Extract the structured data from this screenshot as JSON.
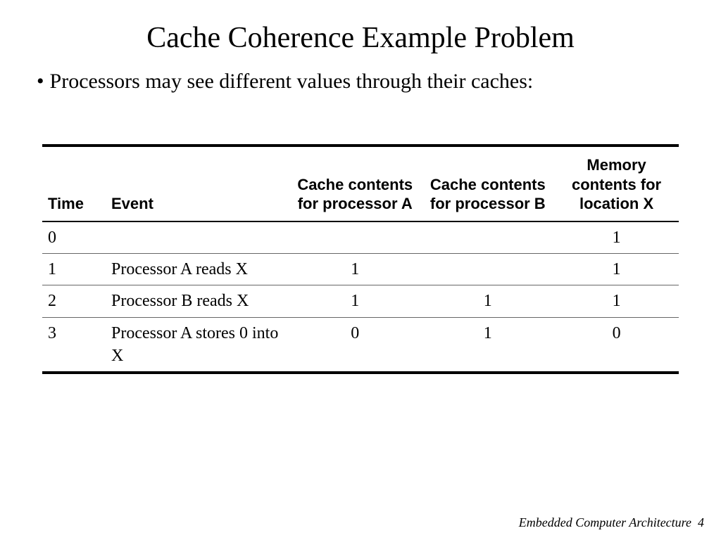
{
  "title": "Cache Coherence Example Problem",
  "bullet": "Processors may see different values through their caches:",
  "table": {
    "headers": {
      "time": "Time",
      "event": "Event",
      "a": "Cache contents for processor A",
      "b": "Cache contents for processor B",
      "x": "Memory contents for location X"
    },
    "rows": [
      {
        "time": "0",
        "event": "",
        "a": "",
        "b": "",
        "x": "1"
      },
      {
        "time": "1",
        "event": "Processor A reads X",
        "a": "1",
        "b": "",
        "x": "1"
      },
      {
        "time": "2",
        "event": "Processor B reads X",
        "a": "1",
        "b": "1",
        "x": "1"
      },
      {
        "time": "3",
        "event": "Processor A stores 0 into X",
        "a": "0",
        "b": "1",
        "x": "0"
      }
    ]
  },
  "footer": {
    "text": "Embedded Computer Architecture",
    "page": "4"
  }
}
